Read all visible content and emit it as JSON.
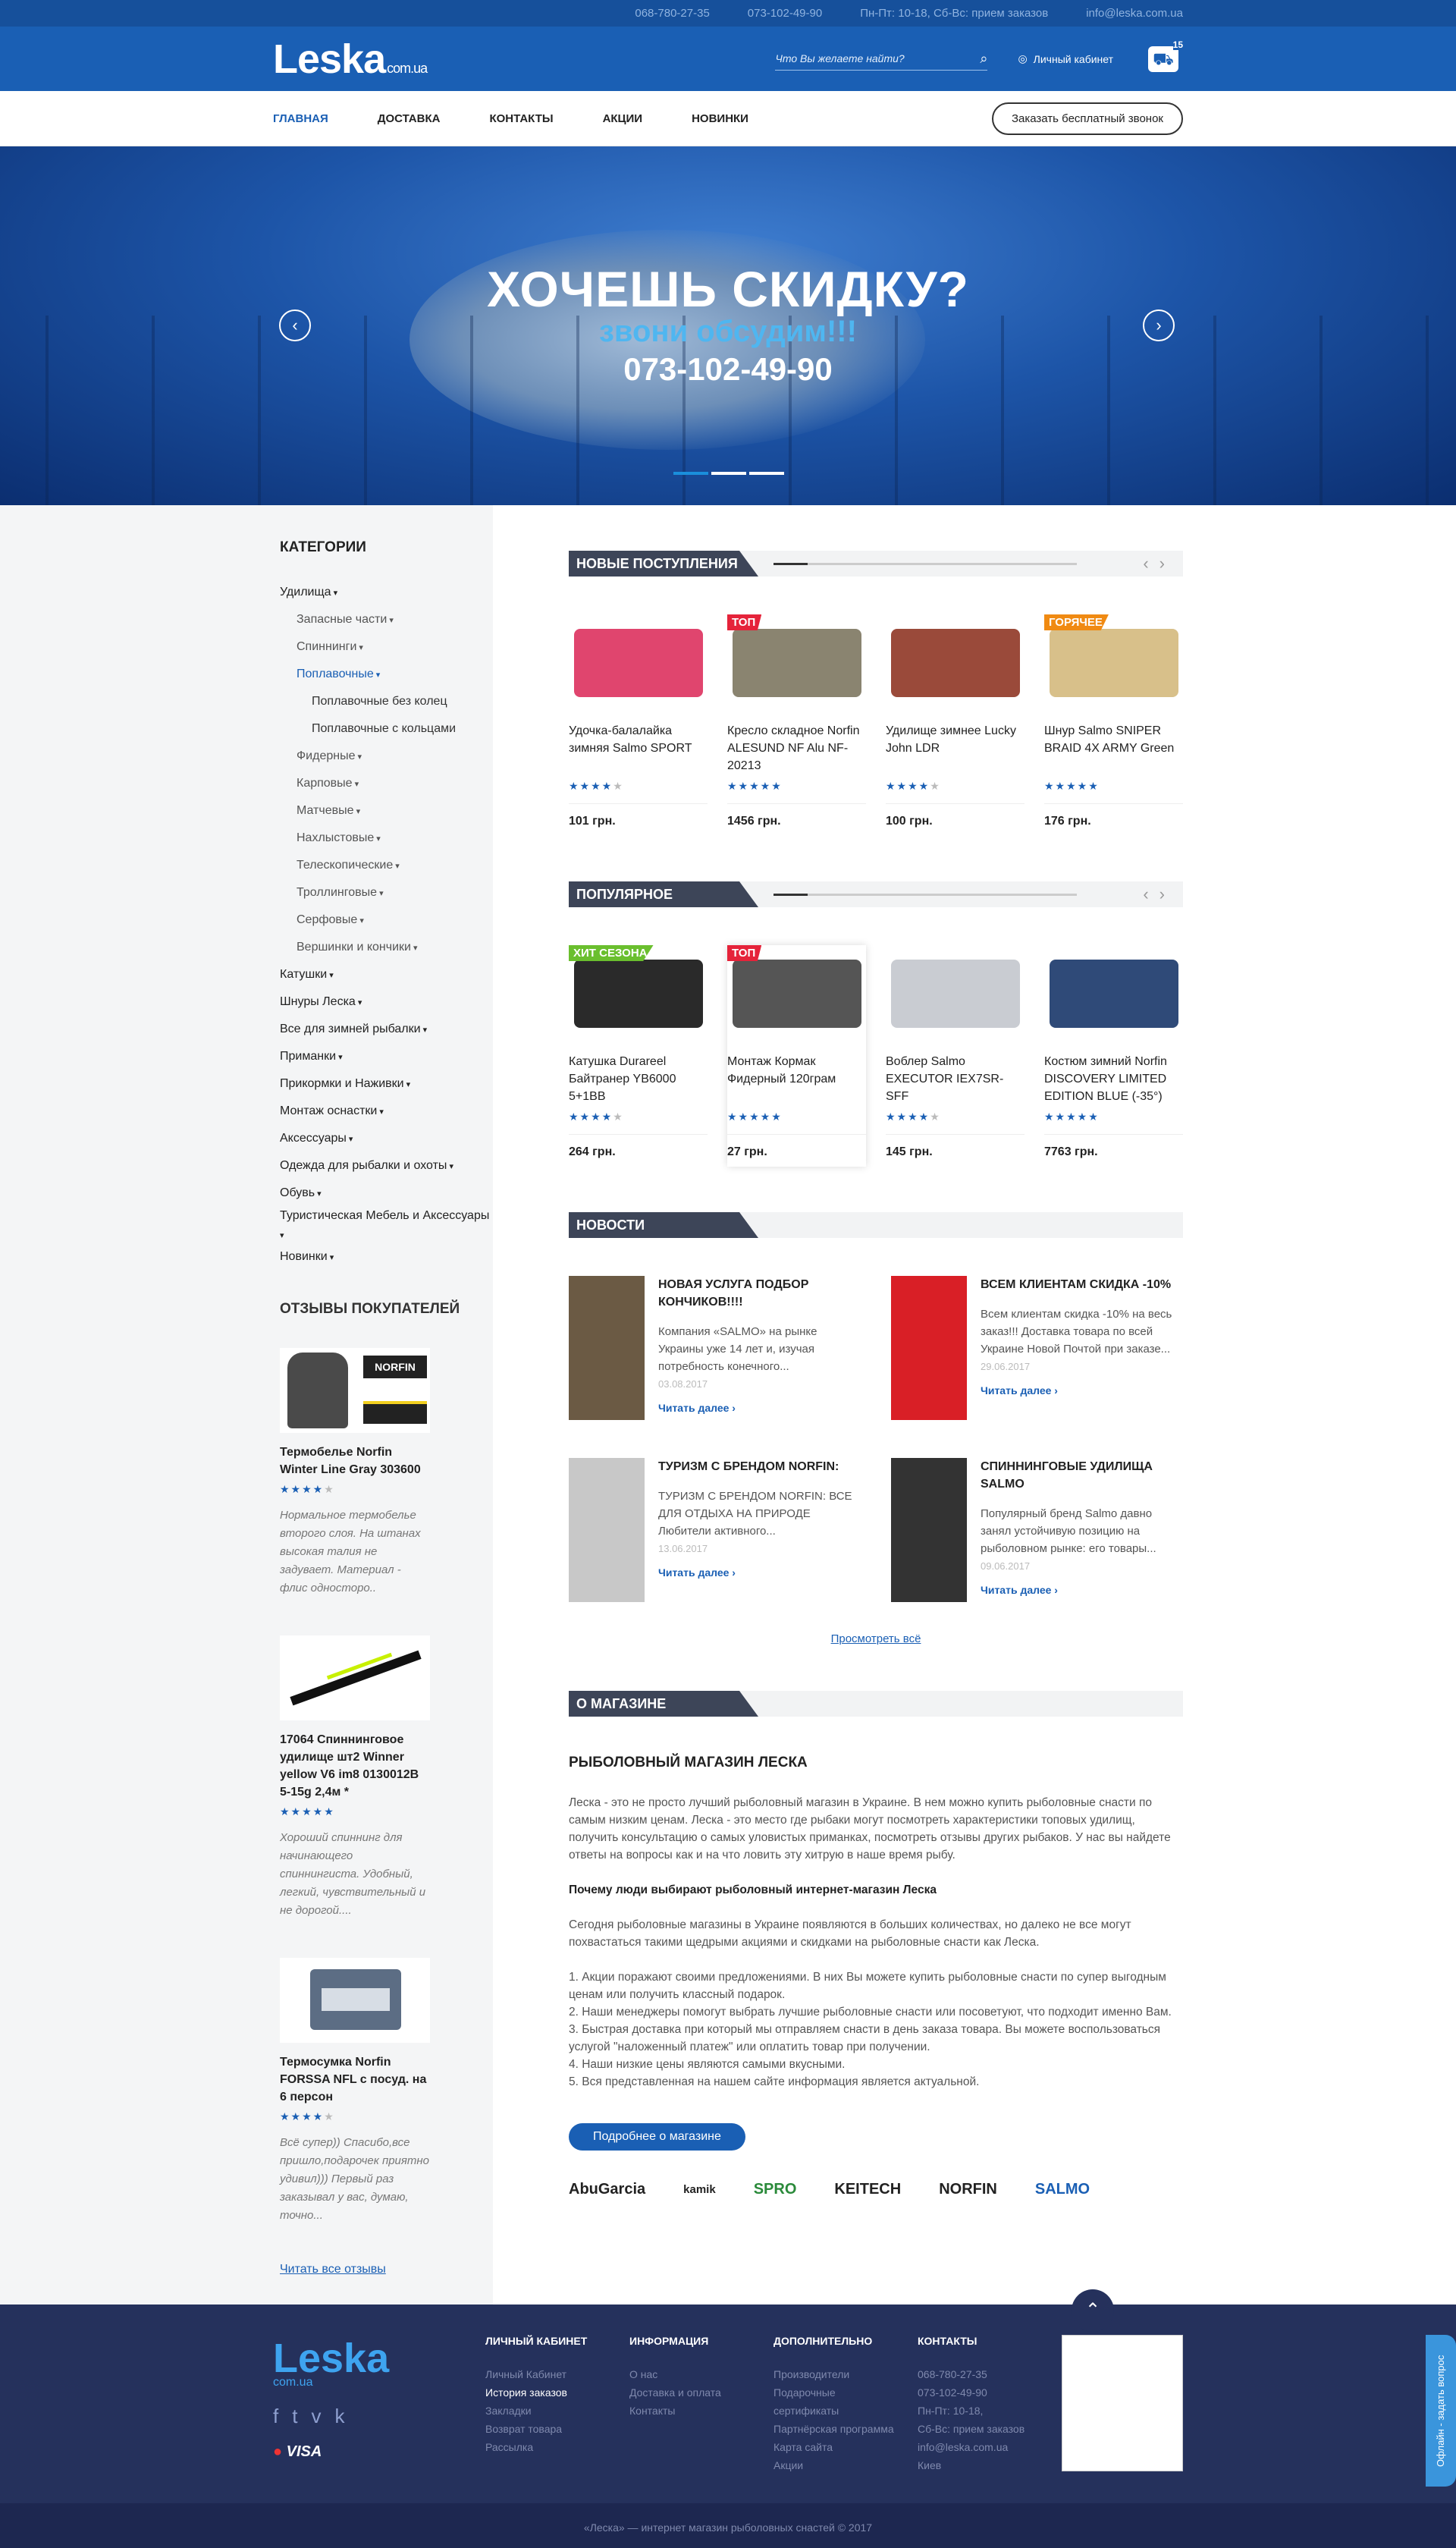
{
  "topbar": {
    "phone1": "068-780-27-35",
    "phone2": "073-102-49-90",
    "hours": "Пн-Пт: 10-18, Сб-Вс: прием заказов",
    "email": "info@leska.com.ua"
  },
  "header": {
    "logo": "Leska",
    "logo_suffix": "com.ua",
    "search_placeholder": "Что Вы желаете найти?",
    "account_label": "Личный кабинет",
    "cart_count": "15"
  },
  "nav": {
    "items": [
      "Главная",
      "Доставка",
      "Контакты",
      "Акции",
      "Новинки"
    ],
    "callback_label": "Заказать бесплатный звонок"
  },
  "banner": {
    "title": "ХОЧЕШЬ СКИДКУ?",
    "subtitle": "звони обсудим!!!",
    "phone": "073-102-49-90"
  },
  "sidebar": {
    "categories_title": "КАТЕГОРИИ",
    "categories": [
      {
        "label": "Удилища",
        "level": 0,
        "active": true
      },
      {
        "label": "Запасные части",
        "level": 1
      },
      {
        "label": "Спиннинги",
        "level": 1
      },
      {
        "label": "Поплавочные",
        "level": 1,
        "active": true
      },
      {
        "label": "Поплавочные без колец",
        "level": 2
      },
      {
        "label": "Поплавочные с кольцами",
        "level": 2
      },
      {
        "label": "Фидерные",
        "level": 1
      },
      {
        "label": "Карповые",
        "level": 1
      },
      {
        "label": "Матчевые",
        "level": 1
      },
      {
        "label": "Нахлыстовые",
        "level": 1
      },
      {
        "label": "Телескопические",
        "level": 1
      },
      {
        "label": "Троллинговые",
        "level": 1
      },
      {
        "label": "Серфовые",
        "level": 1
      },
      {
        "label": "Вершинки и кончики",
        "level": 1
      },
      {
        "label": "Катушки",
        "level": 0
      },
      {
        "label": "Шнуры Леска",
        "level": 0
      },
      {
        "label": "Все для зимней рыбалки",
        "level": 0
      },
      {
        "label": "Приманки",
        "level": 0
      },
      {
        "label": "Прикормки и Наживки",
        "level": 0
      },
      {
        "label": "Монтаж оснастки",
        "level": 0
      },
      {
        "label": "Аксессуары",
        "level": 0
      },
      {
        "label": "Одежда для рыбалки и охоты",
        "level": 0
      },
      {
        "label": "Обувь",
        "level": 0
      },
      {
        "label": "Туристическая Мебель и Аксессуары",
        "level": 0
      },
      {
        "label": "Новинки",
        "level": 0
      }
    ],
    "reviews_title": "ОТЗЫВЫ ПОКУПАТЕЛЕЙ",
    "reviews": [
      {
        "name": "Термобелье Norfin Winter Line Gray 303600",
        "stars": 4,
        "text": "Нормальное термобелье второго слоя. На штанах высокая талия не задувает. Материал - флис односторо.."
      },
      {
        "name": "17064 Спиннинговое удилище шт2 Winner yellow V6 im8 0130012B 5-15g 2,4м *",
        "stars": 5,
        "text": "Хороший спиннинг для начинающего спиннингиста. Удобный, легкий, чувствительный и не дорогой...."
      },
      {
        "name": "Термосумка Norfin FORSSA NFL с посуд. на 6 персон",
        "stars": 4,
        "text": "Всё супер)) Спасибо,все пришло,подарочек приятно удивил))) Первый раз заказывал у вас, думаю, точно..."
      }
    ],
    "all_reviews": "Читать все отзывы"
  },
  "sections": {
    "new": "НОВЫЕ ПОСТУПЛЕНИЯ",
    "popular": "ПОПУЛЯРНОЕ",
    "news": "НОВОСТИ",
    "about": "О МАГАЗИНЕ"
  },
  "new_products": [
    {
      "name": "Удочка-балалайка зимняя Salmo SPORT",
      "stars": 4,
      "price": "101 грн.",
      "badge": "",
      "color": "#e0456e"
    },
    {
      "name": "Кресло складное Norfin ALESUND NF Alu NF-20213",
      "stars": 5,
      "price": "1456 грн.",
      "badge": "ТОП",
      "color": "#8a8470"
    },
    {
      "name": "Удилище зимнее Lucky John LDR",
      "stars": 4,
      "price": "100 грн.",
      "badge": "",
      "color": "#9a4a3a"
    },
    {
      "name": "Шнур Salmo SNIPER BRAID 4X ARMY Green",
      "stars": 5,
      "price": "176 грн.",
      "badge": "ГОРЯЧЕЕ",
      "color": "#d8c08a"
    }
  ],
  "popular_products": [
    {
      "name": "Катушка Durareel Байтранер YB6000 5+1BB",
      "stars": 4,
      "price": "264 грн.",
      "badge": "ХИТ СЕЗОНА",
      "color": "#2a2a2a"
    },
    {
      "name": "Монтаж Кормак Фидерный 120грам",
      "stars": 5,
      "price": "27 грн.",
      "badge": "ТОП",
      "color": "#555"
    },
    {
      "name": "Воблер Salmo EXECUTOR IEX7SR-SFF",
      "stars": 4,
      "price": "145 грн.",
      "badge": "",
      "color": "#c9ccd2"
    },
    {
      "name": "Костюм зимний Norfin DISCOVERY LIMITED EDITION BLUE (-35°)",
      "stars": 5,
      "price": "7763 грн.",
      "badge": "",
      "color": "#2f4a78"
    }
  ],
  "news": [
    {
      "title": "НОВАЯ УСЛУГА ПОДБОР КОНЧИКОВ!!!!",
      "text": "Компания «SALMO» на рынке Украины уже 14 лет и, изучая потребность конечного...",
      "date": "03.08.2017",
      "more": "Читать далее",
      "color": "#6b5a44"
    },
    {
      "title": "ВСЕМ КЛИЕНТАМ СКИДКА -10%",
      "text": "Всем клиентам скидка -10% на весь заказ!!! Доставка товара по всей Украине Новой Почтой при заказе...",
      "date": "29.06.2017",
      "more": "Читать далее",
      "color": "#d91f26"
    },
    {
      "title": "ТУРИЗМ С БРЕНДОМ NORFIN:",
      "text": "ТУРИЗМ С БРЕНДОМ NORFIN: ВСЕ ДЛЯ ОТДЫХА НА ПРИРОДЕ Любители активного...",
      "date": "13.06.2017",
      "more": "Читать далее",
      "color": "#c8c8c8"
    },
    {
      "title": "СПИННИНГОВЫЕ УДИЛИЩА SALMO",
      "text": "Популярный бренд Salmo давно занял устойчивую позицию на рыболовном рынке: его товары...",
      "date": "09.06.2017",
      "more": "Читать далее",
      "color": "#333"
    }
  ],
  "view_all": "Просмотреть всё",
  "about": {
    "title": "РЫБОЛОВНЫЙ МАГАЗИН ЛЕСКА",
    "p1": "Леска - это не просто лучший рыболовный магазин в Украине. В нем можно купить рыболовные снасти по самым низким ценам. Леска - это место где рыбаки могут посмотреть характеристики топовых удилищ, получить консультацию о самых уловистых приманках, посмотреть отзывы других рыбаков. У нас вы найдете ответы на вопросы как и на что ловить эту хитрую в наше время рыбу.",
    "h2": "Почему люди выбирают рыболовный интернет-магазин Леска",
    "p2": "Сегодня рыболовные магазины в Украине появляются в больших количествах, но далеко не все могут похвастаться такими щедрыми акциями и скидками на рыболовные снасти как Леска.",
    "list": [
      "1. Акции поражают своими предложениями. В них Вы можете купить рыболовные снасти по супер выгодным ценам или получить классный подарок.",
      "2. Наши менеджеры помогут выбрать лучшие рыболовные снасти или посоветуют, что подходит именно Вам.",
      "3. Быстрая доставка при который мы отправляем снасти в день заказа товара. Вы можете воспользоваться услугой \"наложенный платеж\" или оплатить товар при получении.",
      "4. Наши низкие цены являются самыми вкусными.",
      "5. Вся представленная на нашем сайте информация является актуальной."
    ],
    "button": "Подробнее о магазине"
  },
  "brands": [
    "AbuGarcia",
    "kamik",
    "SPRO",
    "KEITECH",
    "NORFIN",
    "SALMO"
  ],
  "footer": {
    "logo": "Leska",
    "logo_suffix": "com.ua",
    "cols": [
      {
        "title": "ЛИЧНЫЙ КАБИНЕТ",
        "items": [
          "Личный Кабинет",
          "История заказов",
          "Закладки",
          "Возврат товара",
          "Рассылка"
        ]
      },
      {
        "title": "ИНФОРМАЦИЯ",
        "items": [
          "О нас",
          "Доставка и оплата",
          "Контакты"
        ]
      },
      {
        "title": "ДОПОЛНИТЕЛЬНО",
        "items": [
          "Производители",
          "Подарочные сертификаты",
          "Партнёрская программа",
          "Карта сайта",
          "Акции"
        ]
      },
      {
        "title": "КОНТАКТЫ",
        "items": [
          "068-780-27-35",
          "073-102-49-90",
          "Пн-Пт: 10-18,",
          "Сб-Вс: прием заказов",
          "info@leska.com.ua",
          "Киев"
        ]
      }
    ],
    "pay": "VISA",
    "copyright": "«Леска» — интернет магазин рыболовных снастей © 2017",
    "online": "Офлайн - задать вопрос"
  }
}
